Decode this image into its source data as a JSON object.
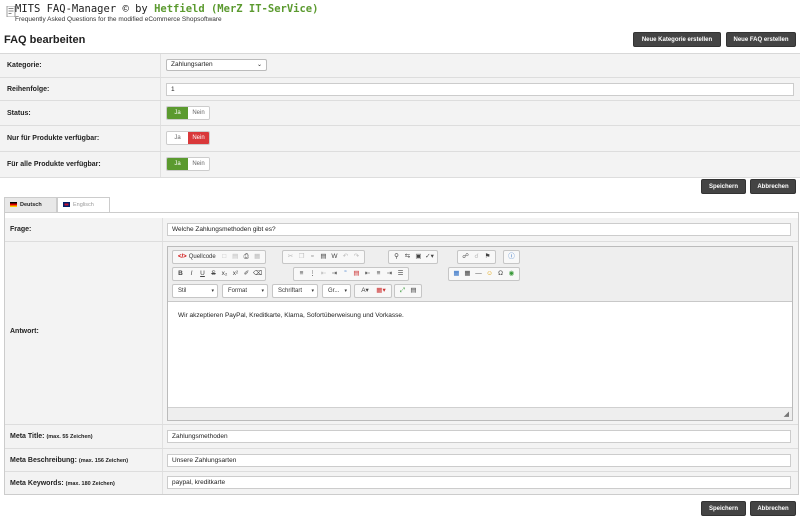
{
  "header": {
    "title_prefix": "MITS FAQ-Manager © by",
    "title_brand": "Hetfield (MerZ IT-SerVice)",
    "subtitle": "Frequently Asked Questions for the modified eCommerce Shopsoftware"
  },
  "page_title": "FAQ bearbeiten",
  "top_buttons": {
    "new_category": "Neue Kategorie erstellen",
    "new_faq": "Neue FAQ erstellen"
  },
  "fields": {
    "kategorie": {
      "label": "Kategorie:",
      "value": "Zahlungsarten"
    },
    "reihenfolge": {
      "label": "Reihenfolge:",
      "value": "1"
    },
    "status": {
      "label": "Status:",
      "yes": "Ja",
      "no": "Nein"
    },
    "nur_produkte": {
      "label": "Nur für Produkte verfügbar:",
      "yes": "Ja",
      "no": "Nein"
    },
    "alle_produkte": {
      "label": "Für alle Produkte verfügbar:",
      "yes": "Ja",
      "no": "Nein"
    }
  },
  "actions": {
    "save": "Speichern",
    "cancel": "Abbrechen"
  },
  "tabs": [
    {
      "label": "Deutsch",
      "active": true
    },
    {
      "label": "Englisch",
      "active": false
    }
  ],
  "lang": {
    "frage": {
      "label": "Frage:",
      "value": "Welche Zahlungsmethoden gibt es?"
    },
    "antwort": {
      "label": "Antwort:"
    },
    "meta_title": {
      "label": "Meta Title:",
      "hint": "(max. 55 Zeichen)",
      "value": "Zahlungsmethoden"
    },
    "meta_desc": {
      "label": "Meta Beschreibung:",
      "hint": "(max. 156 Zeichen)",
      "value": "Unsere Zahlungsarten"
    },
    "meta_keywords": {
      "label": "Meta Keywords:",
      "hint": "(max. 180 Zeichen)",
      "value": "paypal, kreditkarte"
    }
  },
  "editor": {
    "source_label": "Quellcode",
    "style_label": "Stil",
    "format_label": "Format",
    "font_label": "Schriftart",
    "size_label": "Gr...",
    "content": "Wir akzeptieren PayPal, Kreditkarte, Klarna, Sofortüberweisung und Vorkasse."
  },
  "colors": {
    "brand_green": "#5b9a2f",
    "on_green": "#5b9a2f",
    "off_red": "#d9383a",
    "button_dark": "#444444"
  }
}
